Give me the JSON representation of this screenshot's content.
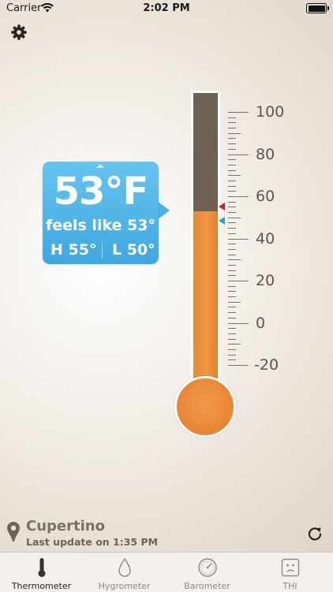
{
  "status_bar": {
    "carrier": "Carrier",
    "time": "2:02 PM"
  },
  "reading": {
    "temperature": "53°F",
    "feels_like": "feels like 53°",
    "high": "H 55°",
    "low": "L 50°",
    "temperature_value": 53,
    "high_value": 55,
    "low_value": 50
  },
  "scale": {
    "min": -20,
    "max": 100,
    "labels": [
      "100",
      "80",
      "60",
      "40",
      "20",
      "0",
      "-20"
    ]
  },
  "location": {
    "city": "Cupertino",
    "last_update": "Last update on 1:35 PM"
  },
  "tabs": [
    {
      "label": "Thermometer",
      "icon": "thermometer-icon",
      "active": true
    },
    {
      "label": "Hygrometer",
      "icon": "droplet-icon",
      "active": false
    },
    {
      "label": "Barometer",
      "icon": "gauge-icon",
      "active": false
    },
    {
      "label": "THI",
      "icon": "sad-face-icon",
      "active": false
    }
  ],
  "colors": {
    "bubble": "#4db1e5",
    "mercury": "#ef9645",
    "tube_empty": "#6f6152",
    "high_marker": "#c0242f",
    "low_marker": "#2ba3c2"
  }
}
